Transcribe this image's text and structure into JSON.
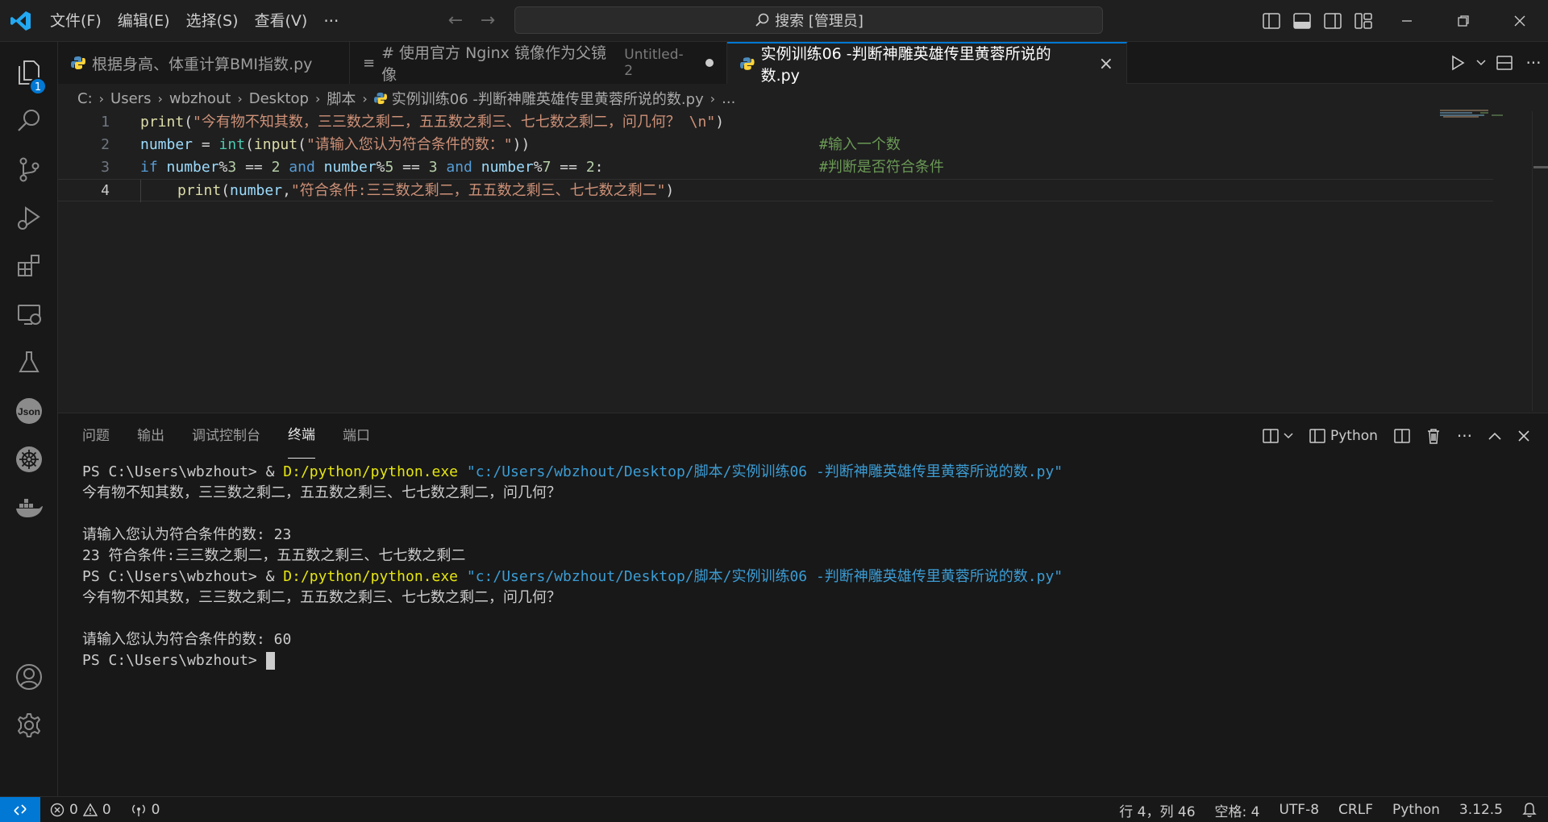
{
  "menu": {
    "file": "文件(F)",
    "edit": "编辑(E)",
    "selection": "选择(S)",
    "view": "查看(V)",
    "more": "···"
  },
  "search": {
    "label": "搜索 [管理员]"
  },
  "activity": {
    "explorer_badge": "1"
  },
  "tabs": [
    {
      "label": "根据身高、体重计算BMI指数.py"
    },
    {
      "label": "# 使用官方 Nginx 镜像作为父镜像",
      "sub": "Untitled-2"
    },
    {
      "label": "实例训练06 -判断神雕英雄传里黄蓉所说的数.py"
    }
  ],
  "breadcrumb": [
    "C:",
    "Users",
    "wbzhout",
    "Desktop",
    "脚本",
    "实例训练06 -判断神雕英雄传里黄蓉所说的数.py",
    "..."
  ],
  "editor": {
    "line_numbers": [
      "1",
      "2",
      "3",
      "4"
    ],
    "l1": {
      "fn": "print",
      "p1": "(",
      "str": "\"今有物不知其数，三三数之剩二，五五数之剩三、七七数之剩二，问几何？ \\n\"",
      "p2": ")"
    },
    "l2": {
      "var": "number",
      "op": " = ",
      "bi": "int",
      "p1": "(",
      "fn": "input",
      "p2": "(",
      "str": "\"请输入您认为符合条件的数：\"",
      "p3": "))",
      "comment": "#输入一个数"
    },
    "l3": {
      "kw_if": "if",
      "v1": " number",
      "o1": "%",
      "n1": "3",
      "o2": " == ",
      "n2": "2",
      "kw_and1": " and",
      "v2": " number",
      "o3": "%",
      "n3": "5",
      "o4": " == ",
      "n4": "3",
      "kw_and2": " and",
      "v3": " number",
      "o5": "%",
      "n5": "7",
      "o6": " == ",
      "n6": "2",
      "o7": ":",
      "comment": "#判断是否符合条件"
    },
    "l4": {
      "fn": "print",
      "p1": "(",
      "var": "number",
      "p2": ",",
      "str": "\"符合条件:三三数之剩二，五五数之剩三、七七数之剩二\"",
      "p3": ")"
    }
  },
  "panel": {
    "tabs": [
      "问题",
      "输出",
      "调试控制台",
      "终端",
      "端口"
    ],
    "active_tab": "终端",
    "shell_label": "Python"
  },
  "terminal": {
    "prompt": "PS C:\\Users\\wbzhout> ",
    "amp": "& ",
    "exe": "D:/python/python.exe",
    "script": " \"c:/Users/wbzhout/Desktop/脚本/实例训练06 -判断神雕英雄传里黄蓉所说的数.py\"",
    "out_question": "今有物不知其数，三三数之剩二，五五数之剩三、七七数之剩二，问几何？",
    "ask_1": "请输入您认为符合条件的数: 23",
    "result_1": "23 符合条件:三三数之剩二，五五数之剩三、七七数之剩二",
    "ask_2": "请输入您认为符合条件的数: 60"
  },
  "status": {
    "errors": "0",
    "warnings": "0",
    "ports": "0",
    "position": "行 4，列 46",
    "spaces": "空格: 4",
    "encoding": "UTF-8",
    "eol": "CRLF",
    "language": "Python",
    "version": "3.12.5"
  },
  "colors": {
    "accent": "#0078d4",
    "string": "#ce9178",
    "keyword": "#569cd6",
    "function": "#dcdcaa",
    "comment": "#6a9955"
  },
  "icons": [
    "vscode-logo-icon",
    "files-icon",
    "search-icon",
    "source-control-icon",
    "run-debug-icon",
    "extensions-icon",
    "remote-explorer-icon",
    "testing-icon",
    "json-icon",
    "kubernetes-icon",
    "docker-icon",
    "account-icon",
    "settings-gear-icon"
  ]
}
